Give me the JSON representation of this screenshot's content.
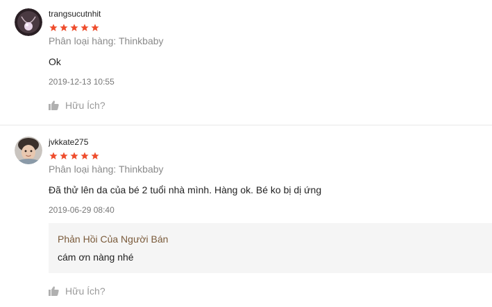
{
  "colors": {
    "star": "#ee4d2d",
    "reply_title": "#7a5a3a",
    "muted": "#8a8a8a"
  },
  "reviews": [
    {
      "username": "trangsucutnhit",
      "rating": 5,
      "variation": "Phân loại hàng: Thinkbaby",
      "comment": "Ok",
      "time": "2019-12-13 10:55",
      "helpful_label": "Hữu Ích?"
    },
    {
      "username": "jvkkate275",
      "rating": 5,
      "variation": "Phân loại hàng: Thinkbaby",
      "comment": "Đã thử lên da của bé 2 tuổi nhà mình. Hàng ok. Bé ko bị dị ứng",
      "time": "2019-06-29 08:40",
      "seller_reply": {
        "title": "Phản Hồi Của Người Bán",
        "text": "cám ơn nàng nhé"
      },
      "helpful_label": "Hữu Ích?"
    }
  ]
}
